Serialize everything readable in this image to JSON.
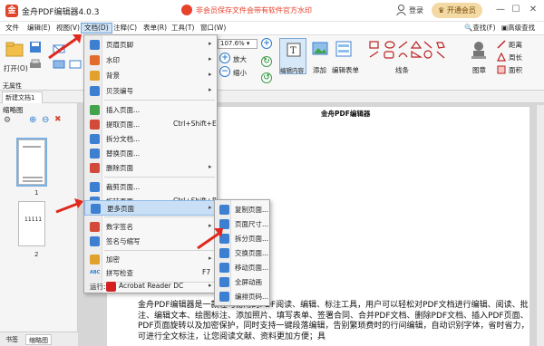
{
  "app": {
    "title": "金舟PDF编辑器4.0.3",
    "promo": "非会员保存文件会带有软件官方水印",
    "login": "登录",
    "vip": "开通会员",
    "logo_char": "金"
  },
  "window_controls": [
    "—",
    "☐",
    "✕"
  ],
  "menubar": {
    "items": [
      "文件",
      "编辑(E)",
      "视图(V)",
      "文档(D)",
      "注释(C)",
      "表单(R)",
      "工具(T)",
      "窗口(W)"
    ],
    "active_index": 3,
    "right": [
      "查找(F)",
      "高级查找(S)"
    ]
  },
  "ribbon": {
    "open_label": "打开(O)",
    "zoom_value": "107.6%",
    "zoom_in": "放大",
    "zoom_out": "缩小",
    "edit_content": "编辑内容",
    "add": "添加",
    "edit_form": "编辑表单",
    "line": "线条",
    "stamp": "图章",
    "distance": "距离",
    "perimeter": "周长",
    "area": "面积",
    "no_attr": "无属性"
  },
  "tab": {
    "label": "新建文档1"
  },
  "left_panel": {
    "title": "缩略图",
    "thumbs": [
      {
        "num": "1",
        "selected": true
      },
      {
        "num": "2",
        "selected": false,
        "text": "11111"
      }
    ],
    "bottom_tabs": [
      "书签",
      "缩略图"
    ]
  },
  "document": {
    "heading": "金舟PDF编辑器",
    "paragraph": "金舟PDF编辑器是一款轻巧易用的PDF阅读、编辑、标注工具，用户可以轻松对PDF文档进行编辑、阅读、批注、编辑文本、绘图标注、添加照片、填写表单、签署合同、合并PDF文档、删除PDF文档、插入PDF页面、PDF页面旋转以及加密保护，同时支持一键段落编辑，告别繁琐费时的行间编辑，自动识别字体，省时省力，可进行全文标注，让您阅读文献、资料更加方便；具"
  },
  "doc_menu": {
    "items": [
      {
        "label": "页眉页脚",
        "arrow": true,
        "color": "#3d7fd1"
      },
      {
        "label": "水印",
        "arrow": true,
        "color": "#e26a2c"
      },
      {
        "label": "背景",
        "arrow": true,
        "color": "#e2a12c"
      },
      {
        "label": "贝茨编号",
        "arrow": true,
        "color": "#3d7fd1"
      },
      {
        "label": "插入页面...",
        "arrow": false,
        "color": "#41a34b"
      },
      {
        "label": "提取页面...",
        "shortcut": "Ctrl+Shift+E",
        "color": "#d44a3a"
      },
      {
        "label": "拆分文档...",
        "arrow": false,
        "color": "#3d7fd1"
      },
      {
        "label": "替换页面...",
        "arrow": false,
        "color": "#3d7fd1"
      },
      {
        "label": "删除页面",
        "arrow": true,
        "color": "#d44a3a"
      },
      {
        "label": "裁剪页面...",
        "arrow": false,
        "color": "#3d7fd1"
      },
      {
        "label": "旋转页面...",
        "shortcut": "Ctrl+Shift+R",
        "color": "#3d7fd1"
      },
      {
        "label": "更多页面",
        "arrow": true,
        "color": "#3d7fd1",
        "highlighted": true
      },
      {
        "label": "数字签名",
        "arrow": true,
        "color": "#d44a3a"
      },
      {
        "label": "签名与缩写",
        "arrow": true,
        "color": "#3d7fd1"
      },
      {
        "label": "加密",
        "arrow": true,
        "color": "#e2a12c"
      },
      {
        "label": "拼写检查",
        "shortcut": "F7",
        "color": "#41a34b",
        "abc": "ABC"
      },
      {
        "label": "运行:",
        "app": "Acrobat Reader DC",
        "arrow": true,
        "color": "#d42020"
      }
    ]
  },
  "sub_menu": {
    "items": [
      {
        "label": "复制页面...",
        "color": "#3d7fd1"
      },
      {
        "label": "页面尺寸...",
        "color": "#3d7fd1"
      },
      {
        "label": "拆分页面...",
        "color": "#3d7fd1"
      },
      {
        "label": "交换页面...",
        "color": "#3d7fd1"
      },
      {
        "label": "移动页面...",
        "color": "#3d7fd1"
      },
      {
        "label": "全屏动画",
        "color": "#3d7fd1"
      },
      {
        "label": "编排页码...",
        "color": "#3d7fd1"
      }
    ]
  },
  "colors": {
    "arrow_red": "#e0281e",
    "highlight": "#c9dff5",
    "accent_blue": "#2d7bd0"
  }
}
